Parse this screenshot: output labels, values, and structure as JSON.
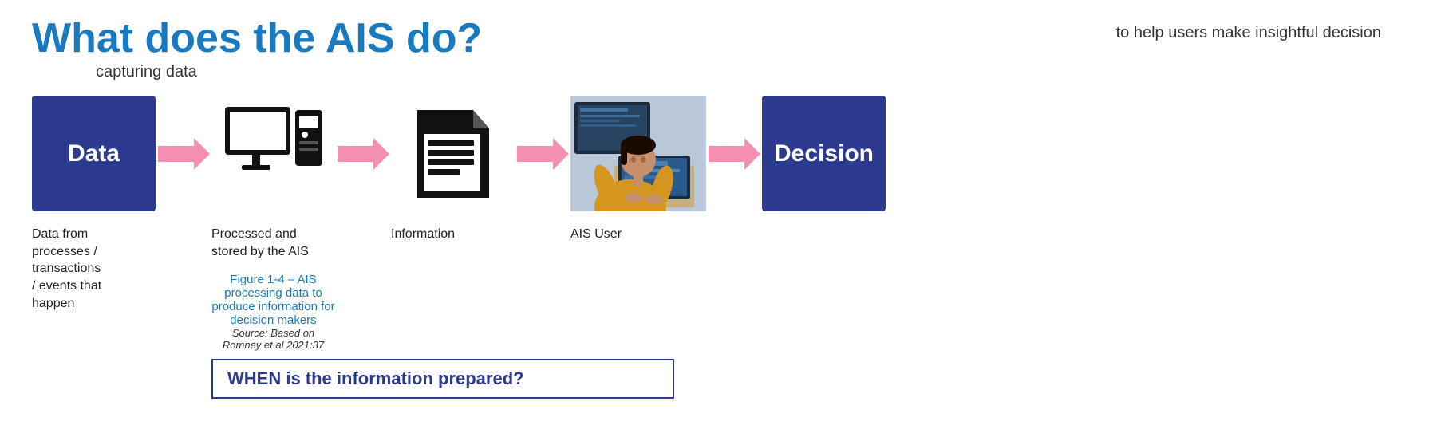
{
  "header": {
    "main_title": "What does the AIS do?",
    "subtitle_handwritten": "capturing data",
    "top_right_handwritten": "to help users make insightful decision"
  },
  "flow": {
    "items": [
      {
        "id": "data-box",
        "type": "box",
        "label": "Data",
        "bg": "#2c3b8e"
      },
      {
        "id": "arrow1",
        "type": "arrow"
      },
      {
        "id": "computer",
        "type": "icon-computer"
      },
      {
        "id": "arrow2",
        "type": "arrow"
      },
      {
        "id": "document",
        "type": "icon-document"
      },
      {
        "id": "arrow3",
        "type": "arrow"
      },
      {
        "id": "ais-user",
        "type": "icon-photo"
      },
      {
        "id": "arrow4",
        "type": "arrow"
      },
      {
        "id": "decision-box",
        "type": "box",
        "label": "Decision",
        "bg": "#2c3b8e"
      }
    ]
  },
  "labels": {
    "data": "Data from\nprocesses /\ntransactions\n/ events that\nhappen",
    "computer": "Processed and\nstored by the AIS",
    "document": "Information",
    "photo": "AIS User",
    "decision": ""
  },
  "figure": {
    "caption_title": "Figure 1-4 – AIS processing data to produce information for decision makers",
    "caption_source": "Source: Based on Romney et al 2021:37"
  },
  "when_box": {
    "title": "WHEN is the information prepared?"
  }
}
